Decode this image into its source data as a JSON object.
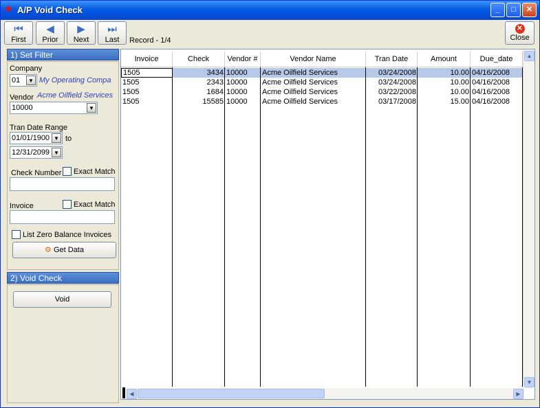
{
  "window": {
    "title": "A/P Void Check",
    "app_icon": "star-icon",
    "controls": [
      "minimize-icon",
      "maximize-icon",
      "close-icon"
    ]
  },
  "toolbar": {
    "first_label": "First",
    "prior_label": "Prior",
    "next_label": "Next",
    "last_label": "Last",
    "record_text": "Record - 1/4",
    "close_label": "Close"
  },
  "filter": {
    "section_title": "1) Set Filter",
    "company_label": "Company",
    "company_value": "01",
    "company_name": "My Operating Compa",
    "vendor_label": "Vendor",
    "vendor_name": "Acme Oilfield Services",
    "vendor_value": "10000",
    "tran_date_label": "Tran Date Range",
    "date_from": "01/01/1900",
    "to_label": "to",
    "date_to": "12/31/2099",
    "check_number_label": "Check Number",
    "exact_match_label": "Exact Match",
    "check_number_value": "",
    "invoice_label": "Invoice",
    "invoice_value": "",
    "list_zero_label": "List Zero Balance Invoices",
    "get_data_label": "Get Data"
  },
  "void_section": {
    "section_title": "2) Void Check",
    "void_label": "Void"
  },
  "grid": {
    "columns": [
      "Invoice",
      "Check",
      "Vendor #",
      "Vendor Name",
      "Tran Date",
      "Amount",
      "Due_date"
    ],
    "rows": [
      [
        "1505",
        "3434",
        "10000",
        "Acme Oilfield Services",
        "03/24/2008",
        "10.00",
        "04/16/2008"
      ],
      [
        "1505",
        "2343",
        "10000",
        "Acme Oilfield Services",
        "03/24/2008",
        "10.00",
        "04/16/2008"
      ],
      [
        "1505",
        "1684",
        "10000",
        "Acme Oilfield Services",
        "03/22/2008",
        "10.00",
        "04/16/2008"
      ],
      [
        "1505",
        "15585",
        "10000",
        "Acme Oilfield Services",
        "03/17/2008",
        "15.00",
        "04/16/2008"
      ]
    ],
    "selected_row": 0
  }
}
